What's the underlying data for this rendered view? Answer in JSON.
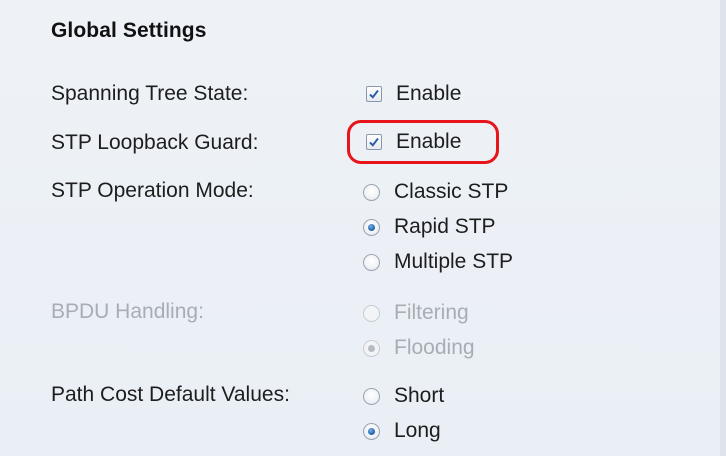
{
  "section": {
    "title": "Global Settings"
  },
  "spanning_tree_state": {
    "label": "Spanning Tree State:",
    "option": {
      "text": "Enable",
      "checked": true
    }
  },
  "loopback_guard": {
    "label": "STP Loopback Guard:",
    "option": {
      "text": "Enable",
      "checked": true
    }
  },
  "operation_mode": {
    "label": "STP Operation Mode:",
    "options": [
      {
        "text": "Classic STP",
        "selected": false
      },
      {
        "text": "Rapid STP",
        "selected": true
      },
      {
        "text": "Multiple STP",
        "selected": false
      }
    ]
  },
  "bpdu_handling": {
    "label": "BPDU Handling:",
    "disabled": true,
    "options": [
      {
        "text": "Filtering",
        "selected": false
      },
      {
        "text": "Flooding",
        "selected": true
      }
    ]
  },
  "path_cost": {
    "label": "Path Cost Default Values:",
    "options": [
      {
        "text": "Short",
        "selected": false
      },
      {
        "text": "Long",
        "selected": true
      }
    ]
  },
  "colors": {
    "highlight": "#e8141b",
    "radio_selected": "#2a6db5",
    "disabled_text": "#a8adb4"
  }
}
